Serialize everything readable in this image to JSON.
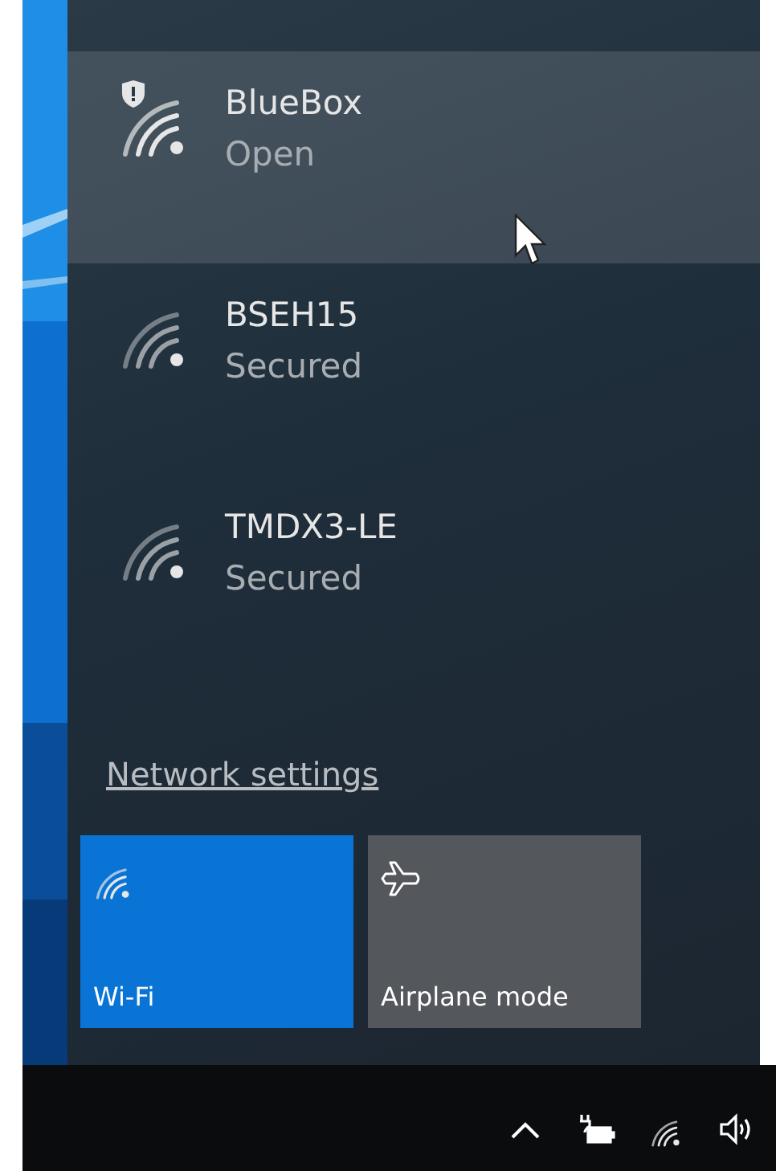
{
  "networks": [
    {
      "name": "BlueBox",
      "status": "Open",
      "hovered": true,
      "warning": true
    },
    {
      "name": "BSEH15",
      "status": "Secured",
      "hovered": false,
      "warning": false
    },
    {
      "name": "TMDX3-LE",
      "status": "Secured",
      "hovered": false,
      "warning": false
    }
  ],
  "settings_link": "Network settings",
  "tiles": [
    {
      "kind": "wifi",
      "label": "Wi-Fi",
      "on": true
    },
    {
      "kind": "airplane",
      "label": "Airplane mode",
      "on": false
    }
  ]
}
